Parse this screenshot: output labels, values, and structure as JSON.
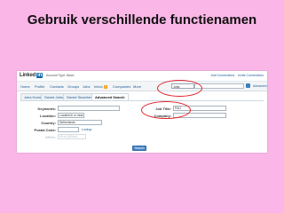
{
  "slide": {
    "title": "Gebruik verschillende functienamen"
  },
  "header": {
    "logo_text": "Linked",
    "logo_in": "in",
    "account_type": "Account Type: Basic",
    "links": [
      "Add Connections",
      "Invite Connections"
    ]
  },
  "nav": {
    "items": [
      "Home",
      "Profile",
      "Contacts",
      "Groups",
      "Jobs",
      "Inbox",
      "Companies",
      "More"
    ],
    "inbox_badge": "4",
    "search_value": "Jobs",
    "advanced_label": "Advanced"
  },
  "tabs": [
    "Jobs Home",
    "Saved Jobs",
    "Saved Searches",
    "Advanced Search"
  ],
  "form": {
    "keywords_label": "Keywords:",
    "location_label": "Location:",
    "location_value": "Located in or near:",
    "country_label": "Country:",
    "country_value": "Netherlands",
    "postal_label": "Postal Code:",
    "postal_lookup": "Lookup",
    "within_label": "Within:",
    "within_value": "50 mi (80 km)",
    "jobtitle_label": "Job Title:",
    "jobtitle_value": "P&O",
    "company_label": "Company:",
    "search_button": "Search"
  },
  "colors": {
    "background": "#f9b6e6",
    "highlight": "#e0202a",
    "link": "#1a5a96"
  }
}
